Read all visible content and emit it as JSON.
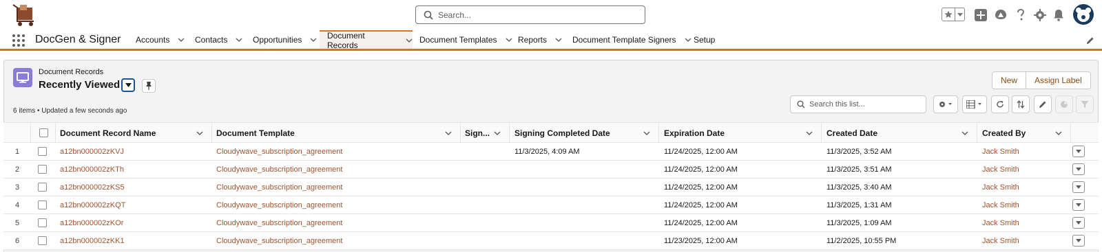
{
  "header": {
    "search_placeholder": "Search...",
    "icons": [
      "favorites-star-icon",
      "add-icon",
      "trailhead-icon",
      "help-icon",
      "setup-gear-icon",
      "notifications-bell-icon",
      "user-avatar"
    ]
  },
  "nav": {
    "app_name": "DocGen & Signer",
    "items": [
      {
        "label": "Accounts"
      },
      {
        "label": "Contacts"
      },
      {
        "label": "Opportunities"
      },
      {
        "label": "Document Records",
        "active": true
      },
      {
        "label": "Document Templates"
      },
      {
        "label": "Reports"
      },
      {
        "label": "Document Template Signers"
      },
      {
        "label": "Setup"
      }
    ]
  },
  "list_view": {
    "object_label": "Document Records",
    "title": "Recently Viewed",
    "meta": "6 items • Updated a few seconds ago",
    "buttons": {
      "new": "New",
      "assign_label": "Assign Label"
    },
    "search_placeholder": "Search this list..."
  },
  "table": {
    "columns": [
      "Document Record Name",
      "Document Template",
      "Sign...",
      "Signing Completed Date",
      "Expiration Date",
      "Created Date",
      "Created By"
    ],
    "rows": [
      {
        "num": "1",
        "name": "a12bn000002zKVJ",
        "template": "Cloudywave_subscription_agreement",
        "signed": "",
        "signing_completed": "11/3/2025, 4:09 AM",
        "expiration": "11/24/2025, 12:00 AM",
        "created": "11/3/2025, 3:52 AM",
        "created_by": "Jack Smith"
      },
      {
        "num": "2",
        "name": "a12bn000002zKTh",
        "template": "Cloudywave_subscription_agreement",
        "signed": "",
        "signing_completed": "",
        "expiration": "11/24/2025, 12:00 AM",
        "created": "11/3/2025, 3:51 AM",
        "created_by": "Jack Smith"
      },
      {
        "num": "3",
        "name": "a12bn000002zKS5",
        "template": "Cloudywave_subscription_agreement",
        "signed": "",
        "signing_completed": "",
        "expiration": "11/24/2025, 12:00 AM",
        "created": "11/3/2025, 3:40 AM",
        "created_by": "Jack Smith"
      },
      {
        "num": "4",
        "name": "a12bn000002zKQT",
        "template": "Cloudywave_subscription_agreement",
        "signed": "",
        "signing_completed": "",
        "expiration": "11/24/2025, 12:00 AM",
        "created": "11/3/2025, 1:31 AM",
        "created_by": "Jack Smith"
      },
      {
        "num": "5",
        "name": "a12bn000002zKOr",
        "template": "Cloudywave_subscription_agreement",
        "signed": "",
        "signing_completed": "",
        "expiration": "11/24/2025, 12:00 AM",
        "created": "11/3/2025, 1:09 AM",
        "created_by": "Jack Smith"
      },
      {
        "num": "6",
        "name": "a12bn000002zKK1",
        "template": "Cloudywave_subscription_agreement",
        "signed": "",
        "signing_completed": "",
        "expiration": "11/23/2025, 12:00 AM",
        "created": "11/2/2025, 10:55 PM",
        "created_by": "Jack Smith"
      }
    ]
  },
  "colors": {
    "accent": "#d5732b",
    "link": "#a0522d",
    "object_icon": "#8b7bd6"
  }
}
